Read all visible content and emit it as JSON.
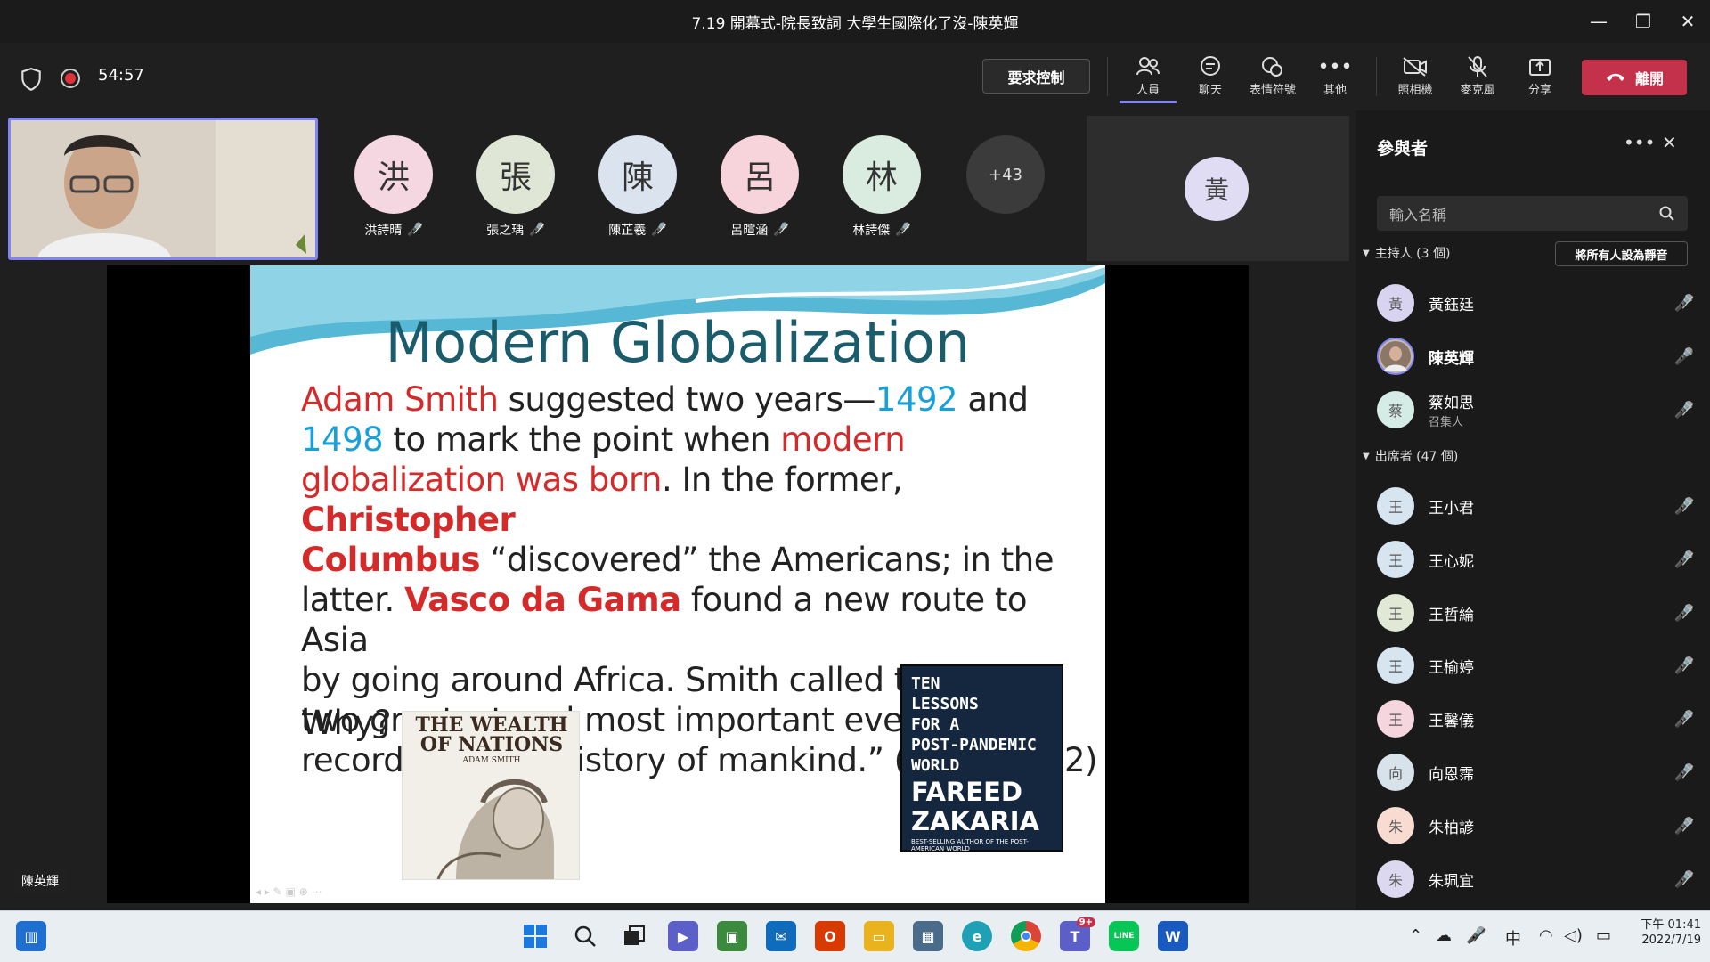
{
  "window": {
    "title": "7.19 開幕式-院長致詞 大學生國際化了沒-陳英輝",
    "minimize": "—",
    "restore": "❐",
    "close": "✕"
  },
  "meeting": {
    "timer": "54:57",
    "request_control": "要求控制",
    "toolbar": {
      "people": "人員",
      "chat": "聊天",
      "reactions": "表情符號",
      "more": "其他",
      "camera": "照相機",
      "mic": "麥克風",
      "share": "分享",
      "leave": "離開"
    }
  },
  "gallery": {
    "participants": [
      {
        "initial": "洪",
        "name": "洪詩晴",
        "color": "#f4d7e0"
      },
      {
        "initial": "張",
        "name": "張之瑀",
        "color": "#dfe6d5"
      },
      {
        "initial": "陳",
        "name": "陳芷羲",
        "color": "#dbe3ee"
      },
      {
        "initial": "呂",
        "name": "呂暄涵",
        "color": "#f7d4dc"
      },
      {
        "initial": "林",
        "name": "林詩傑",
        "color": "#d9ecdf"
      }
    ],
    "overflow": "+43",
    "host_initial": "黃"
  },
  "presenter": {
    "name": "陳英輝"
  },
  "slide": {
    "title": "Modern Globalization",
    "p1a": "Adam Smith",
    "p1b": " suggested two years—",
    "p1c": "1492",
    "p1d": " and",
    "p2a": "1498",
    "p2b": " to mark the point when ",
    "p2c": "modern",
    "p3a": "globalization was born",
    "p3b": ". In the former, ",
    "p3c": "Christopher",
    "p4a": "Columbus",
    "p4b": "  “discovered”  the Americans; in the",
    "p5a": "latter. ",
    "p5b": "Vasco da Gama",
    "p5c": " found a new route to Asia",
    "p6": "by going around Africa. Smith called these  “the",
    "p7": "two greatest and most  important events",
    "p8": "recorded in the history of mankind.”  (Z",
    "p8end": "2)",
    "why": "Why?",
    "wealth_title_1": "THE WEALTH",
    "wealth_title_2": "OF NATIONS",
    "wealth_author": "ADAM SMITH",
    "book_lines": [
      "TEN",
      "LESSONS",
      "FOR A",
      "POST-PANDEMIC",
      "WORLD"
    ],
    "book_author_1": "FAREED",
    "book_author_2": "ZAKARIA",
    "book_footer": "BEST-SELLING AUTHOR OF THE POST-AMERICAN WORLD"
  },
  "panel": {
    "title": "參與者",
    "search_placeholder": "輸入名稱",
    "hosts_label": "主持人 (3 個)",
    "mute_all": "將所有人設為靜音",
    "hosts": [
      {
        "initial": "黃",
        "name": "黃鈺廷",
        "sub": "",
        "color": "#d8d4ef"
      },
      {
        "initial": "",
        "name": "陳英輝",
        "sub": "",
        "color": "#c9b9a8"
      },
      {
        "initial": "蔡",
        "name": "蔡如思",
        "sub": "召集人",
        "color": "#d5ece6"
      }
    ],
    "attendees_label": "出席者 (47 個)",
    "attendees": [
      {
        "initial": "王",
        "name": "王小君",
        "color": "#d6e5f0"
      },
      {
        "initial": "王",
        "name": "王心妮",
        "color": "#d6e5f0"
      },
      {
        "initial": "王",
        "name": "王哲綸",
        "color": "#e2e8d6"
      },
      {
        "initial": "王",
        "name": "王榆婷",
        "color": "#d6e5f0"
      },
      {
        "initial": "王",
        "name": "王馨儀",
        "color": "#f5d6de"
      },
      {
        "initial": "向",
        "name": "向恩霈",
        "color": "#d8e2ea"
      },
      {
        "initial": "朱",
        "name": "朱柏諺",
        "color": "#f8dcd2"
      },
      {
        "initial": "朱",
        "name": "朱珮宜",
        "color": "#dcd8ef"
      }
    ]
  },
  "taskbar": {
    "ime": "中",
    "time": "下午 01:41",
    "date": "2022/7/19",
    "teams_badge": "9+"
  }
}
